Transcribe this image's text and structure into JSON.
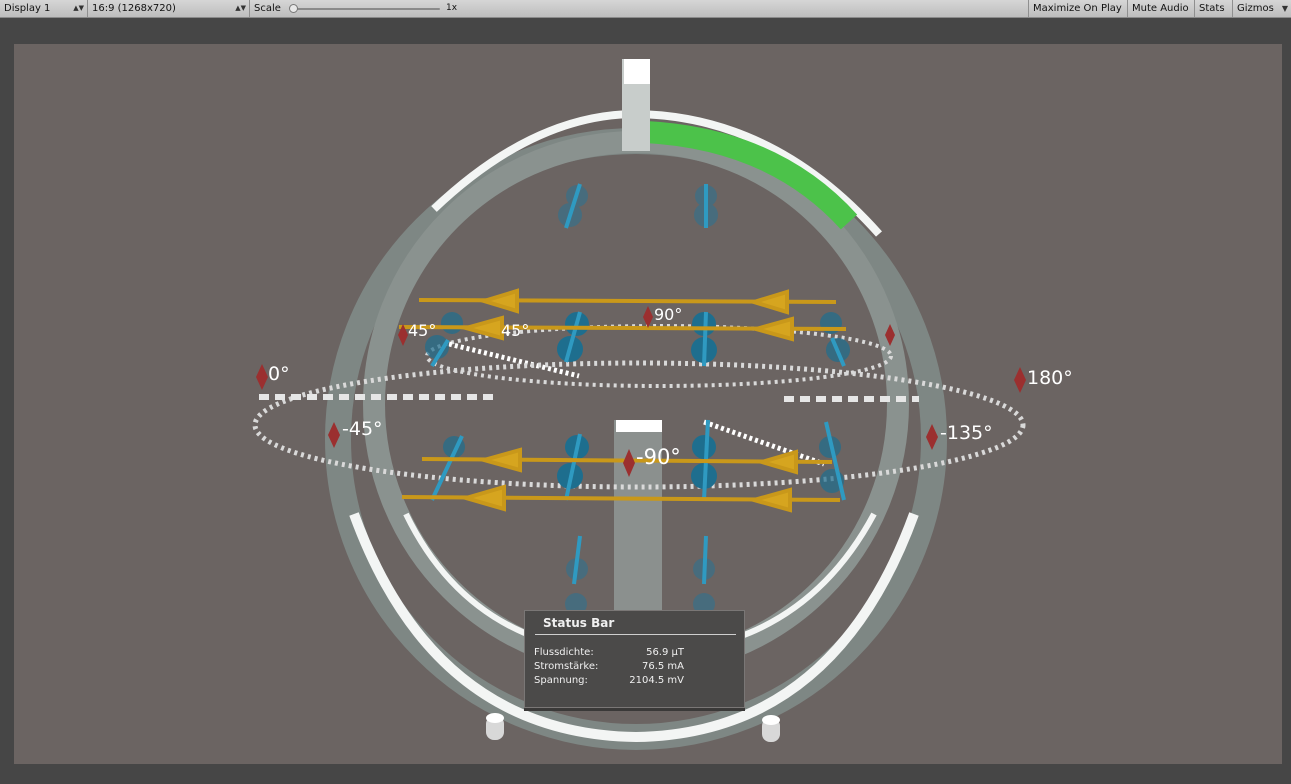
{
  "toolbar": {
    "display": "Display 1",
    "aspect": "16:9 (1268x720)",
    "scale_label": "Scale",
    "scale_value": "1x",
    "maximize": "Maximize On Play",
    "mute": "Mute Audio",
    "stats": "Stats",
    "gizmos": "Gizmos"
  },
  "scene": {
    "angle_labels": {
      "a0": "0°",
      "a45": "45°",
      "a45b": "45°",
      "a90": "90°",
      "a180": "180°",
      "a_neg45": "-45°",
      "a_neg90": "-90°",
      "a_neg135": "-135°"
    },
    "colors": {
      "background": "#6b6462",
      "ring": "#8e9693",
      "ring_highlight": "#e8ecea",
      "progress": "#4cc24a",
      "conductor": "#d2a21c",
      "compass": "#1e6e8e",
      "marker": "#9b2f2f"
    }
  },
  "status_bar": {
    "title": "Status Bar",
    "rows": [
      {
        "label": "Flussdichte:",
        "value": "56.9 µT"
      },
      {
        "label": "Stromstärke:",
        "value": "76.5 mA"
      },
      {
        "label": "Spannung:",
        "value": "2104.5 mV"
      }
    ]
  }
}
